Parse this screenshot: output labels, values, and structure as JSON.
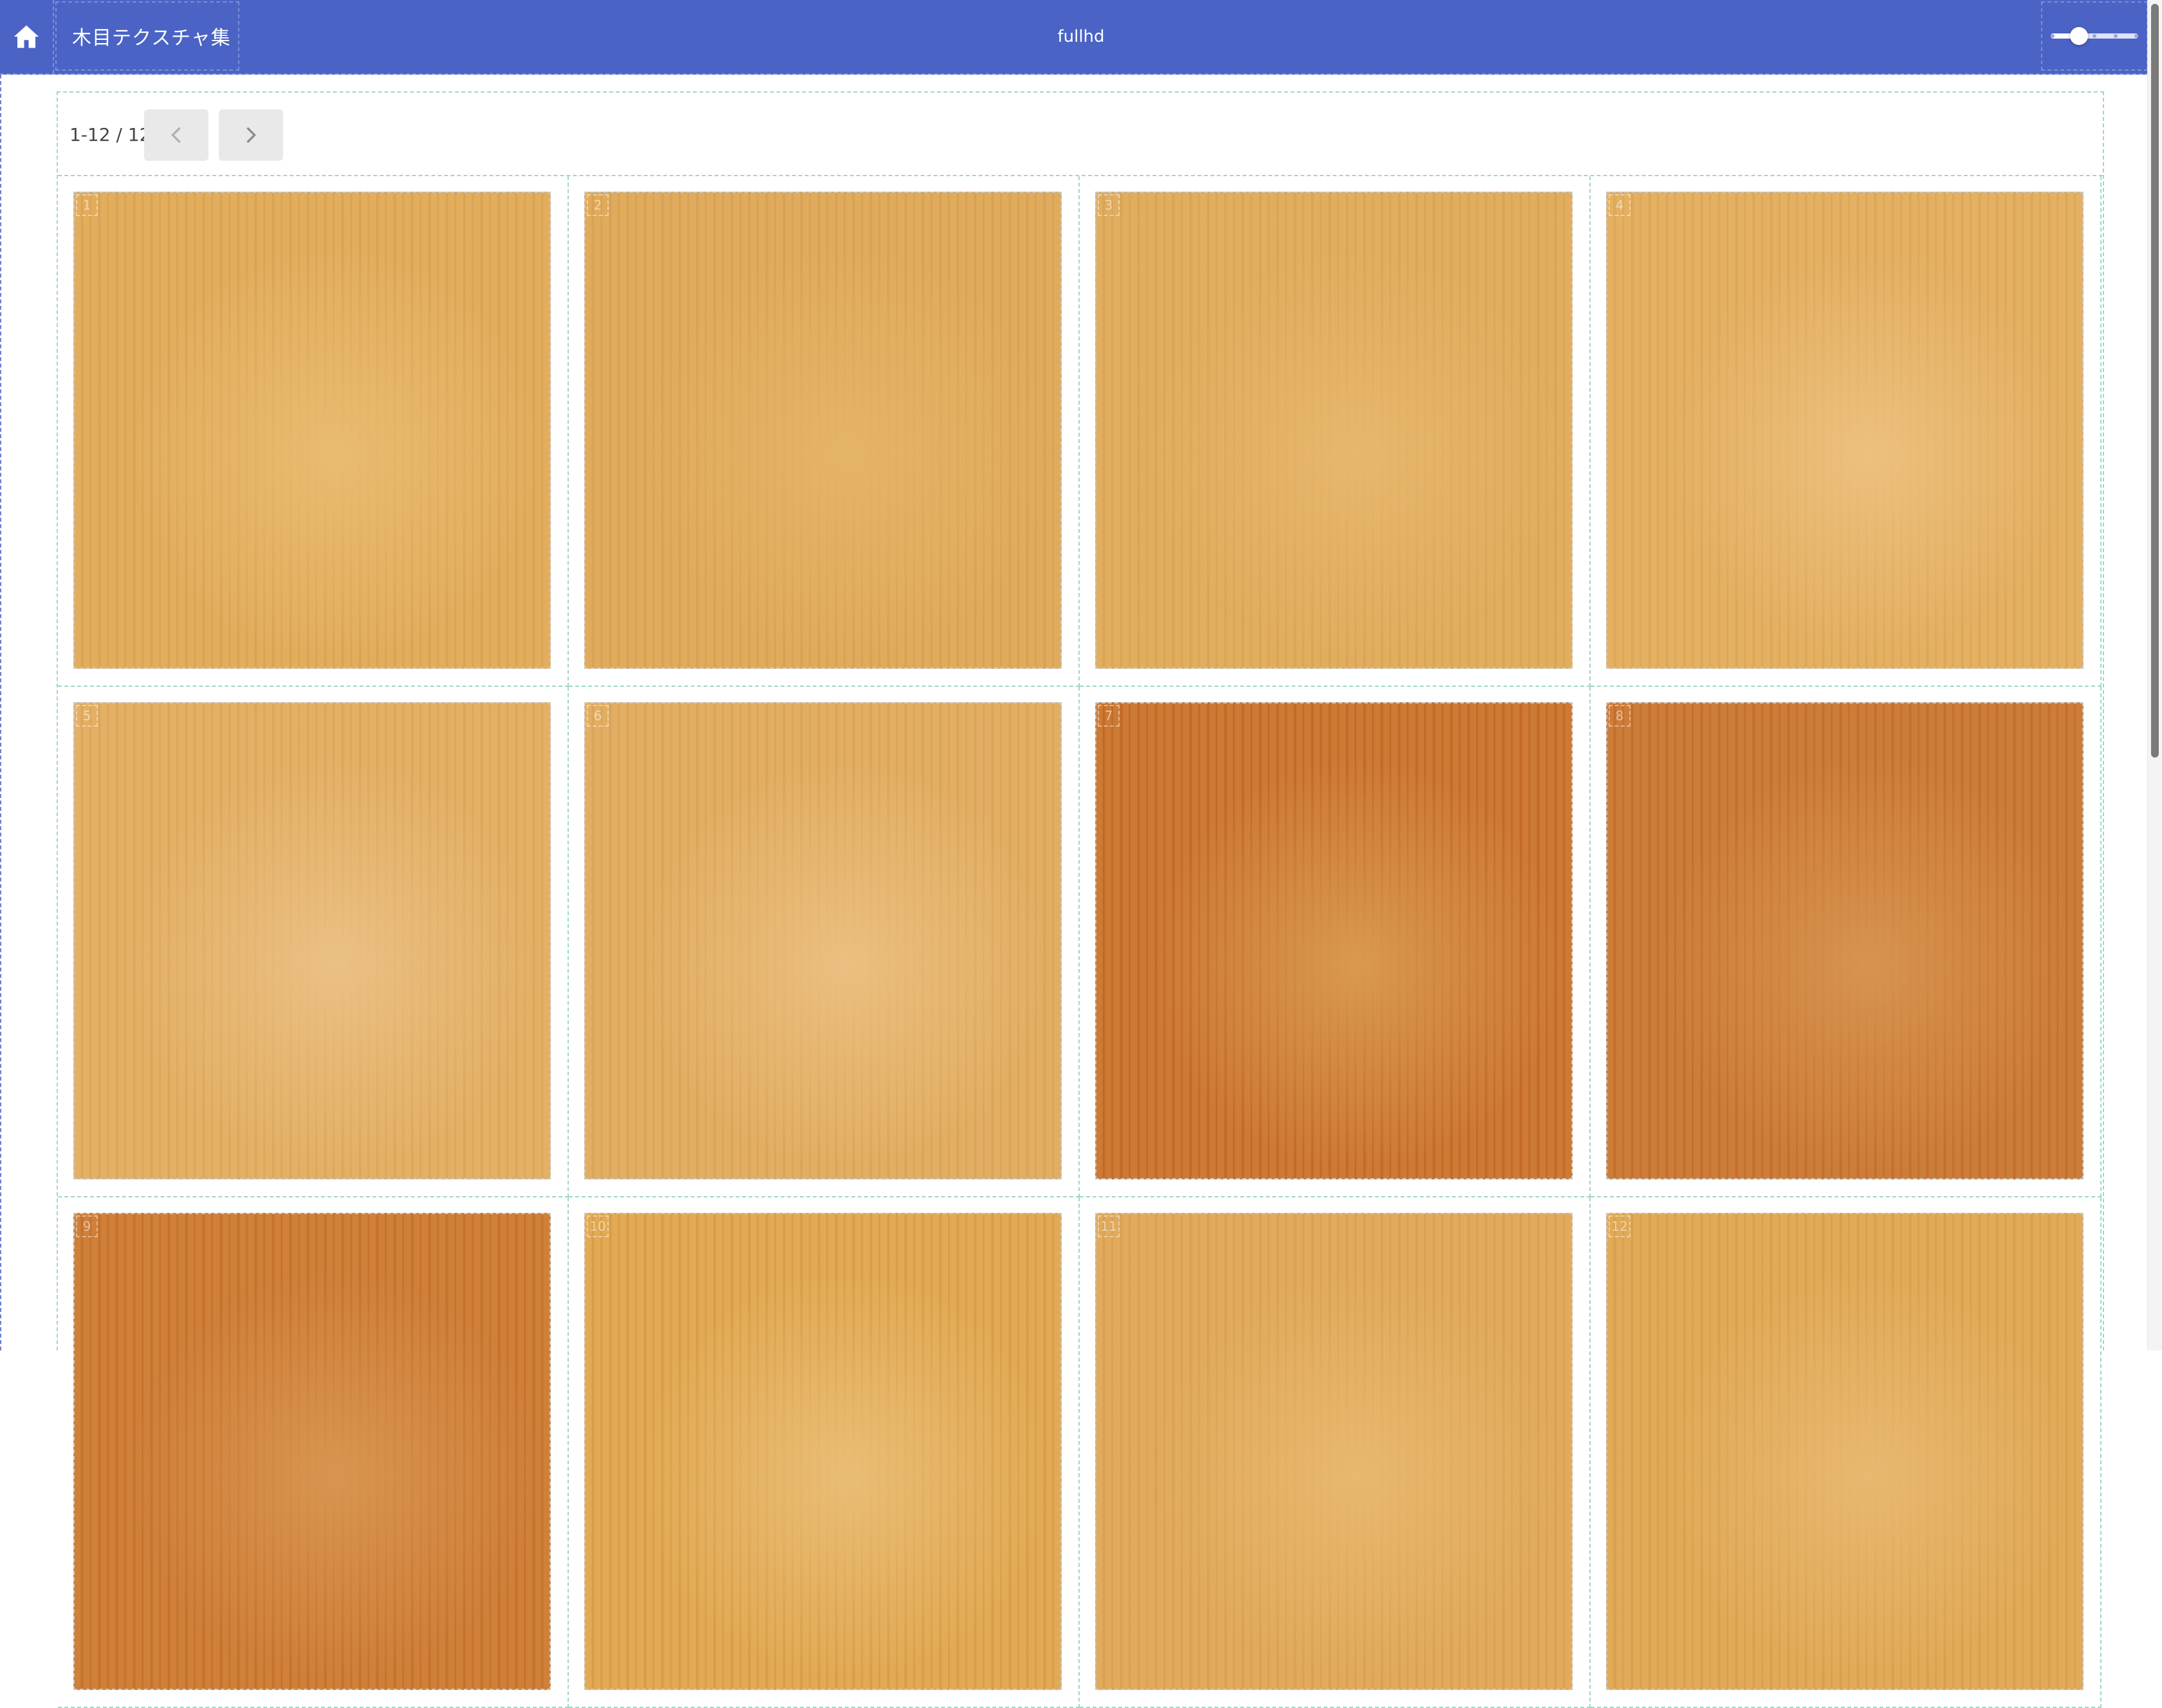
{
  "header": {
    "home_icon": "home-icon",
    "title": "木目テクスチャ集",
    "center_label": "fullhd",
    "slider": {
      "value_fraction": 0.32,
      "steps": 5
    }
  },
  "pagination": {
    "range_text": "1-12 / 12",
    "prev_icon": "chevron-left-icon",
    "next_icon": "chevron-right-icon"
  },
  "tiles": [
    {
      "index": "1",
      "base": "#e2ae5e",
      "grain": "#d8a04f",
      "light": "#e9bb70"
    },
    {
      "index": "2",
      "base": "#e0ab5c",
      "grain": "#d69f50",
      "light": "#e5b468"
    },
    {
      "index": "3",
      "base": "#e1ad5f",
      "grain": "#d7a253",
      "light": "#e7b76c"
    },
    {
      "index": "4",
      "base": "#e4b062",
      "grain": "#dba457",
      "light": "#ecc07e"
    },
    {
      "index": "5",
      "base": "#e3b066",
      "grain": "#d9a456",
      "light": "#ebc084"
    },
    {
      "index": "6",
      "base": "#e2ae63",
      "grain": "#d8a255",
      "light": "#ebbf80"
    },
    {
      "index": "7",
      "base": "#cd7a35",
      "grain": "#c06322",
      "light": "#d9994f"
    },
    {
      "index": "8",
      "base": "#cd7d3a",
      "grain": "#c26a28",
      "light": "#d7944f"
    },
    {
      "index": "9",
      "base": "#cf8039",
      "grain": "#c46c28",
      "light": "#d89550"
    },
    {
      "index": "10",
      "base": "#e2aa55",
      "grain": "#d6993f",
      "light": "#e9bd75"
    },
    {
      "index": "11",
      "base": "#e1aa5c",
      "grain": "#d79e4d",
      "light": "#e8b86e"
    },
    {
      "index": "12",
      "base": "#e1aa58",
      "grain": "#d79d48",
      "light": "#e8b870"
    }
  ],
  "colors": {
    "header_bg": "#4a63c4",
    "grid_border": "#9fd8c4"
  }
}
